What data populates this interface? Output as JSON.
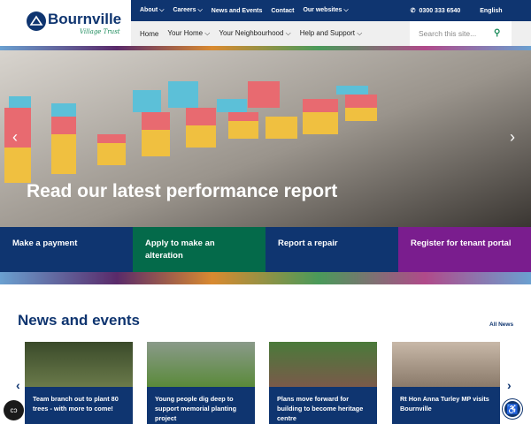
{
  "brand": {
    "name": "Bournville",
    "tagline": "Village Trust"
  },
  "topbar": {
    "items": [
      "About ⌵",
      "Careers ⌵",
      "News and Events",
      "Contact",
      "Our websites ⌵"
    ],
    "phone": "0300 333 6540",
    "language": "English"
  },
  "nav": {
    "items": [
      "Home",
      "Your Home ⌵",
      "Your Neighbourhood ⌵",
      "Help and Support ⌵"
    ],
    "search_placeholder": "Search this site..."
  },
  "hero": {
    "title": "Read our latest performance report",
    "prev": "‹",
    "next": "›"
  },
  "tiles": [
    {
      "label": "Make a payment",
      "color": "#0f3570"
    },
    {
      "label": "Apply to make an alteration",
      "color": "#046a4a"
    },
    {
      "label": "Report a repair",
      "color": "#0f3570"
    },
    {
      "label": "Register for tenant portal",
      "color": "#7a1d8e"
    }
  ],
  "news": {
    "title": "News and events",
    "all_link": "All News",
    "prev": "‹",
    "next": "›",
    "cards": [
      {
        "title": "Team branch out to plant 80 trees - with more to come!"
      },
      {
        "title": "Young people dig deep to support memorial planting project"
      },
      {
        "title": "Plans move forward for building to become heritage centre"
      },
      {
        "title": "Rt Hon Anna Turley MP visits Bournville"
      }
    ]
  }
}
